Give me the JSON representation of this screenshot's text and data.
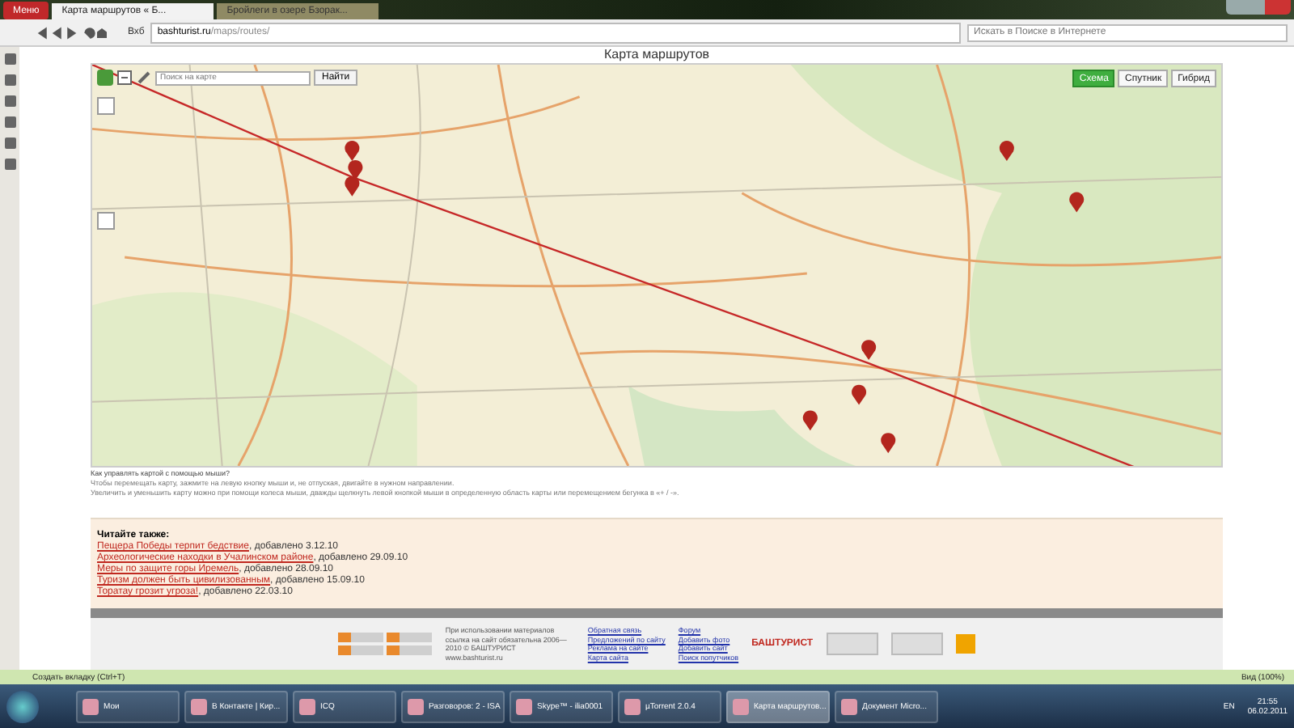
{
  "browser": {
    "menu": "Меню",
    "tabs": [
      {
        "title": "Карта маршрутов « Б...",
        "selected": true
      },
      {
        "title": "Бройлеги в озере Бзорак...",
        "selected": false
      }
    ],
    "address": "bashturist.ru",
    "address_path": "/maps/routes/",
    "speed_dial": "Вхб",
    "search_placeholder": "Искать в Поиске в Интернете"
  },
  "page": {
    "title": "Карта маршрутов",
    "map": {
      "search_placeholder": "Поиск на карте",
      "search_button": "Найти",
      "types": [
        {
          "label": "Схема",
          "selected": true
        },
        {
          "label": "Спутник",
          "selected": false
        },
        {
          "label": "Гибрид",
          "selected": false
        }
      ]
    },
    "help": {
      "title": "Как управлять картой с помощью мыши?",
      "lines": [
        "Чтобы перемещать карту, зажмите на левую кнопку мыши и, не отпуская, двигайте в нужном направлении.",
        "Увеличить и уменьшить карту можно при помощи колеса мыши, дважды щелкнуть левой кнопкой мыши в определенную область карты или перемещением бегунка в «+ / -»."
      ]
    },
    "read_also": {
      "title": "Читайте также:",
      "items": [
        {
          "link": "Пещера Победы терпит бедствие",
          "added": ", добавлено 3.12.10"
        },
        {
          "link": "Археологические находки в Учалинском районе",
          "added": ", добавлено 29.09.10"
        },
        {
          "link": "Меры по защите горы Иремель",
          "added": ", добавлено 28.09.10"
        },
        {
          "link": "Туризм должен быть цивилизованным",
          "added": ", добавлено 15.09.10"
        },
        {
          "link": "Торатау грозит угроза!",
          "added": ", добавлено 22.03.10"
        }
      ]
    },
    "footer": {
      "copyright": "При использовании материалов ссылка на сайт обязательна 2006—2010 © БАШТУРИСТ www.bashturist.ru",
      "links_1": [
        "Обратная связь",
        "Предложений по сайту",
        "Реклама на сайте",
        "Карта сайта"
      ],
      "links_2": [
        "Форум",
        "Добавить фото",
        "Добавить сайт",
        "Поиск попутчиков"
      ],
      "logo": "БАШТУРИСТ"
    }
  },
  "status_bar": {
    "new_tab": "Создать вкладку (Ctrl+T)",
    "zoom": "Вид (100%)"
  },
  "taskbar": {
    "items": [
      {
        "label": "Мои",
        "selected": false
      },
      {
        "label": "В Контакте | Кир...",
        "selected": false
      },
      {
        "label": "ICQ",
        "selected": false
      },
      {
        "label": "Разговоров: 2 - ISA",
        "selected": false
      },
      {
        "label": "Skype™ - ilia0001",
        "selected": false
      },
      {
        "label": "µTorrent 2.0.4",
        "selected": false
      },
      {
        "label": "Карта маршрутов...",
        "selected": true
      },
      {
        "label": "Документ Micro...",
        "selected": false
      }
    ],
    "language": "EN",
    "time": "21:55",
    "date": "06.02.2011"
  }
}
